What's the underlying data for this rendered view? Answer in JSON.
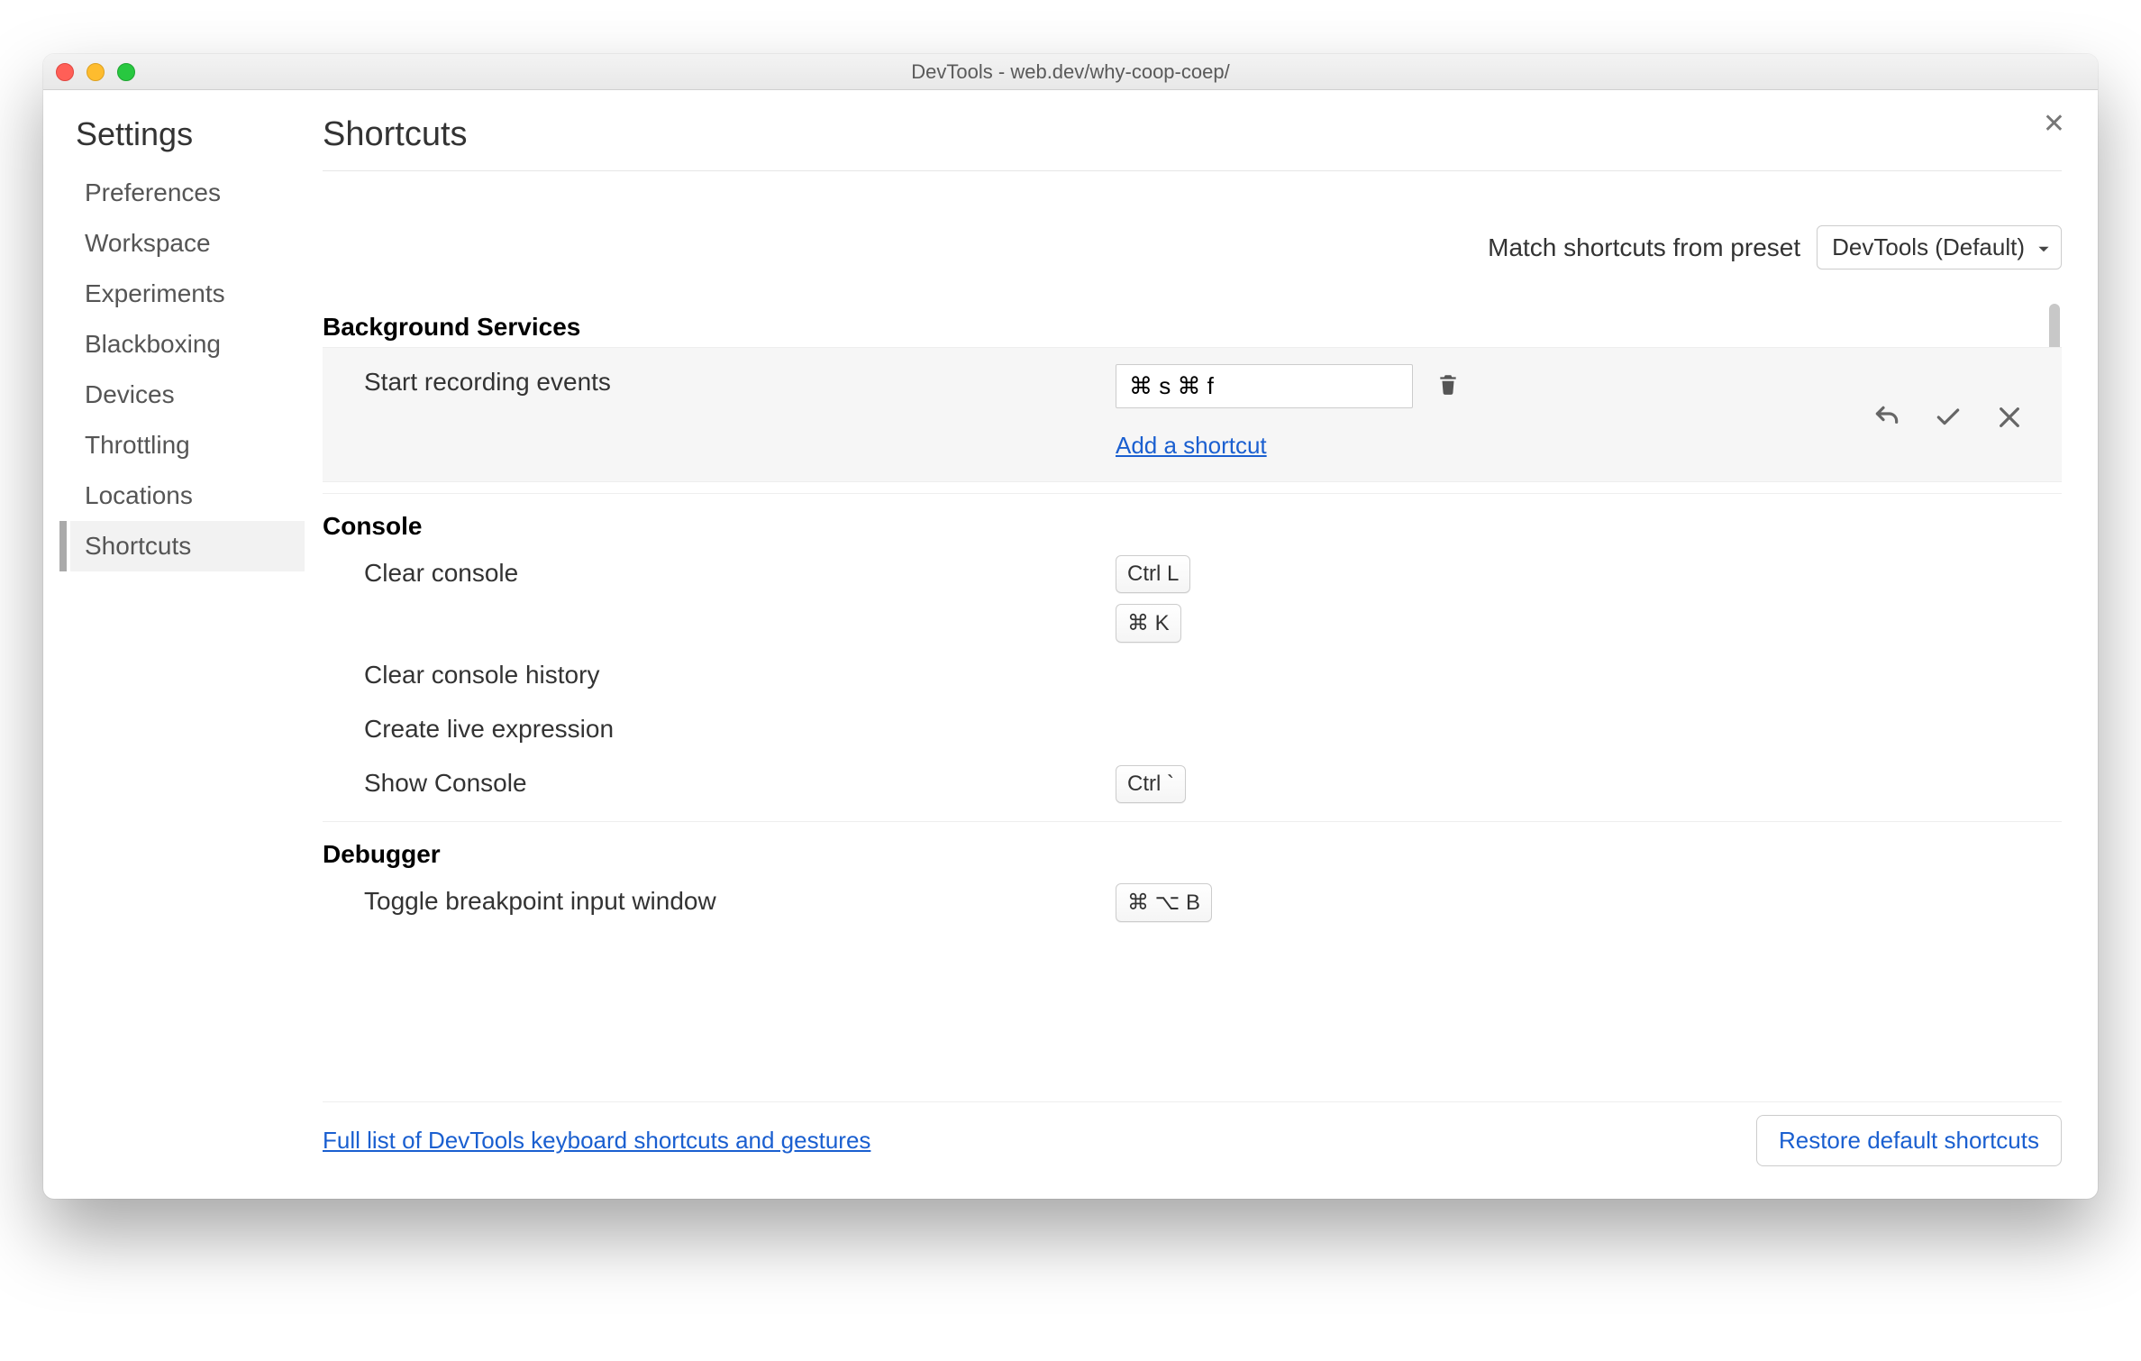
{
  "window": {
    "title": "DevTools - web.dev/why-coop-coep/"
  },
  "sidebar": {
    "title": "Settings",
    "items": [
      {
        "label": "Preferences"
      },
      {
        "label": "Workspace"
      },
      {
        "label": "Experiments"
      },
      {
        "label": "Blackboxing"
      },
      {
        "label": "Devices"
      },
      {
        "label": "Throttling"
      },
      {
        "label": "Locations"
      },
      {
        "label": "Shortcuts"
      }
    ],
    "activeIndex": 7
  },
  "main": {
    "title": "Shortcuts",
    "preset": {
      "label": "Match shortcuts from preset",
      "value": "DevTools (Default)"
    },
    "addShortcutLabel": "Add a shortcut",
    "sections": {
      "background": {
        "title": "Background Services",
        "startRecording": {
          "label": "Start recording events",
          "editingValue": "⌘ s ⌘ f"
        }
      },
      "console": {
        "title": "Console",
        "clearConsole": {
          "label": "Clear console",
          "key1": "Ctrl L",
          "key2": "⌘ K"
        },
        "clearHistory": {
          "label": "Clear console history"
        },
        "createLive": {
          "label": "Create live expression"
        },
        "showConsole": {
          "label": "Show Console",
          "key1": "Ctrl `"
        }
      },
      "debugger": {
        "title": "Debugger",
        "toggleBp": {
          "label": "Toggle breakpoint input window",
          "key1": "⌘ ⌥ B"
        }
      }
    },
    "footer": {
      "link": "Full list of DevTools keyboard shortcuts and gestures",
      "restore": "Restore default shortcuts"
    }
  }
}
